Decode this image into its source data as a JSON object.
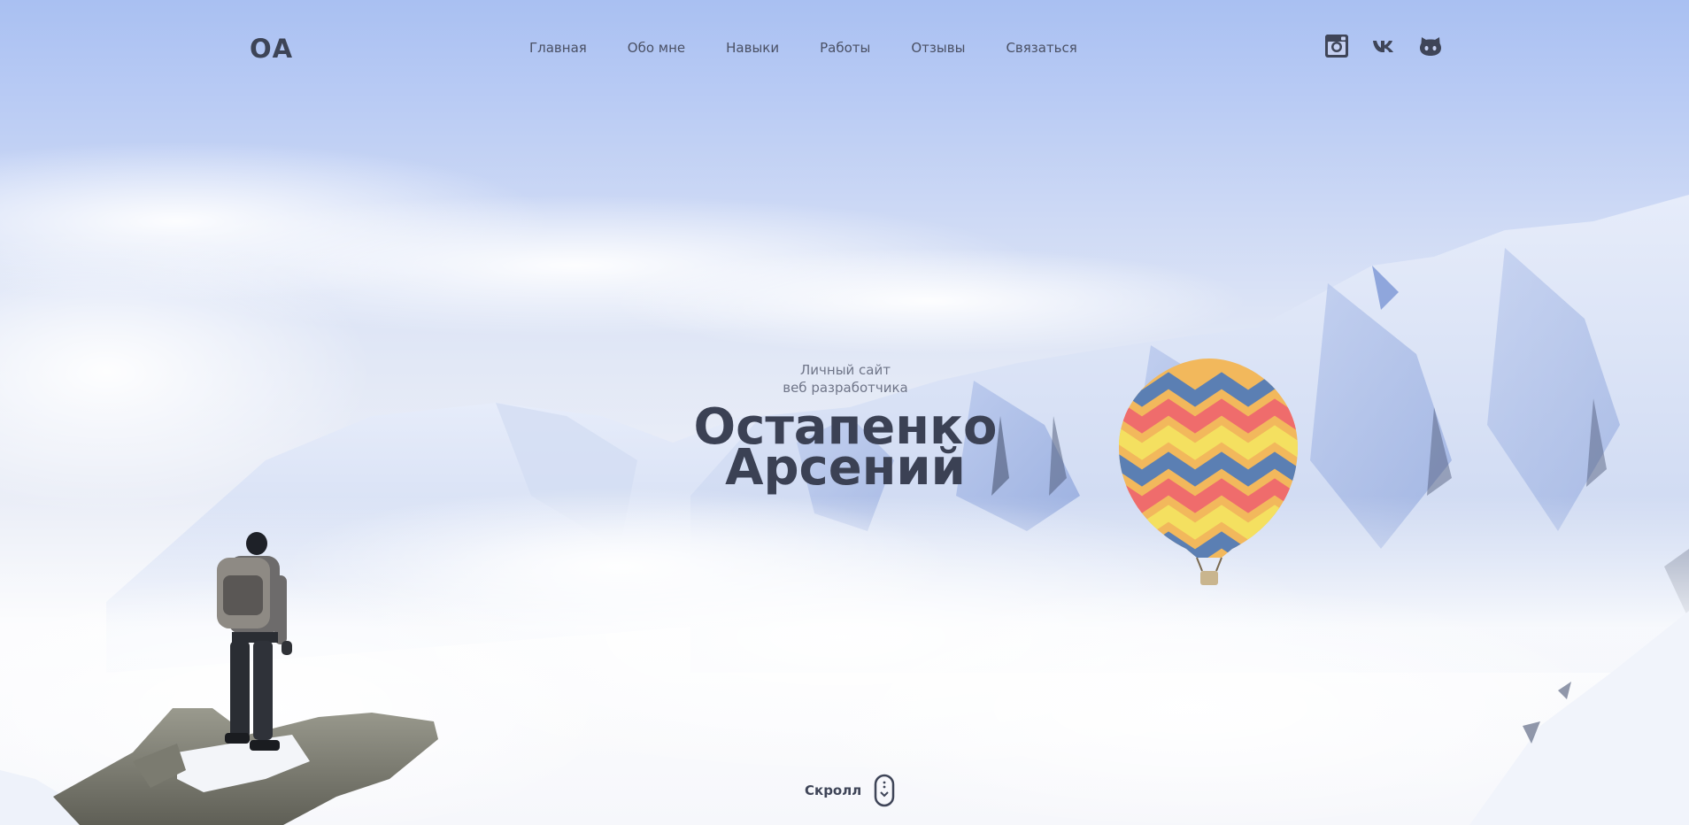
{
  "header": {
    "logo": "ОА",
    "nav": [
      {
        "label": "Главная"
      },
      {
        "label": "Обо мне"
      },
      {
        "label": "Навыки"
      },
      {
        "label": "Работы"
      },
      {
        "label": "Отзывы"
      },
      {
        "label": "Связаться"
      }
    ],
    "socials": [
      {
        "icon": "instagram-icon"
      },
      {
        "icon": "vk-icon"
      },
      {
        "icon": "github-icon"
      }
    ]
  },
  "intro": {
    "subtitle_line1": "Личный сайт",
    "subtitle_line2": "веб разработчика",
    "name_line1": "Остапенко",
    "name_line2": "Арсений"
  },
  "scroll": {
    "label": "Скролл",
    "icon": "mouse-scroll-icon"
  },
  "colors": {
    "text_dark": "#3b4154",
    "sky_top": "#a9c0f2",
    "snow": "#eef1f8"
  }
}
